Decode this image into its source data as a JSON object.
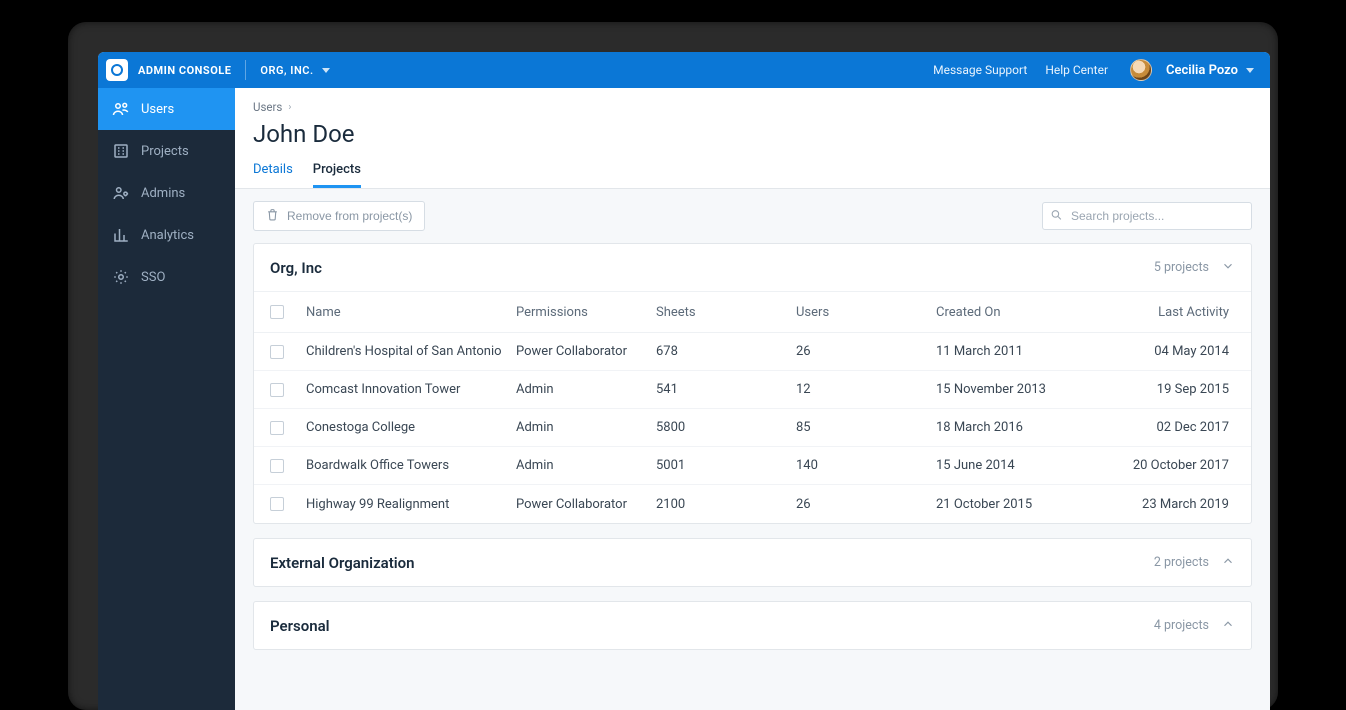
{
  "header": {
    "brand": "ADMIN CONSOLE",
    "org": "ORG, INC.",
    "links": {
      "support": "Message Support",
      "help": "Help Center"
    },
    "user": "Cecilia Pozo"
  },
  "sidebar": {
    "items": [
      {
        "id": "users",
        "label": "Users"
      },
      {
        "id": "projects",
        "label": "Projects"
      },
      {
        "id": "admins",
        "label": "Admins"
      },
      {
        "id": "analytics",
        "label": "Analytics"
      },
      {
        "id": "sso",
        "label": "SSO"
      }
    ]
  },
  "breadcrumb": {
    "root": "Users"
  },
  "page": {
    "title": "John Doe",
    "tabs": {
      "details": "Details",
      "projects": "Projects"
    },
    "remove_label": "Remove from project(s)",
    "search_placeholder": "Search projects..."
  },
  "table_headers": {
    "name": "Name",
    "permissions": "Permissions",
    "sheets": "Sheets",
    "users": "Users",
    "created": "Created On",
    "activity": "Last Activity"
  },
  "groups": [
    {
      "title": "Org, Inc",
      "count": "5 projects",
      "expanded": true,
      "rows": [
        {
          "name": "Children's Hospital of San Antonio",
          "perm": "Power Collaborator",
          "sheets": "678",
          "users": "26",
          "created": "11 March 2011",
          "activity": "04 May 2014"
        },
        {
          "name": "Comcast Innovation Tower",
          "perm": "Admin",
          "sheets": "541",
          "users": "12",
          "created": "15 November 2013",
          "activity": "19 Sep 2015"
        },
        {
          "name": "Conestoga College",
          "perm": "Admin",
          "sheets": "5800",
          "users": "85",
          "created": "18 March 2016",
          "activity": "02 Dec 2017"
        },
        {
          "name": "Boardwalk Office Towers",
          "perm": "Admin",
          "sheets": "5001",
          "users": "140",
          "created": "15 June 2014",
          "activity": "20 October 2017"
        },
        {
          "name": "Highway 99 Realignment",
          "perm": "Power Collaborator",
          "sheets": "2100",
          "users": "26",
          "created": "21 October 2015",
          "activity": "23 March 2019"
        }
      ]
    },
    {
      "title": "External Organization",
      "count": "2 projects",
      "expanded": false,
      "rows": []
    },
    {
      "title": "Personal",
      "count": "4 projects",
      "expanded": false,
      "rows": []
    }
  ]
}
